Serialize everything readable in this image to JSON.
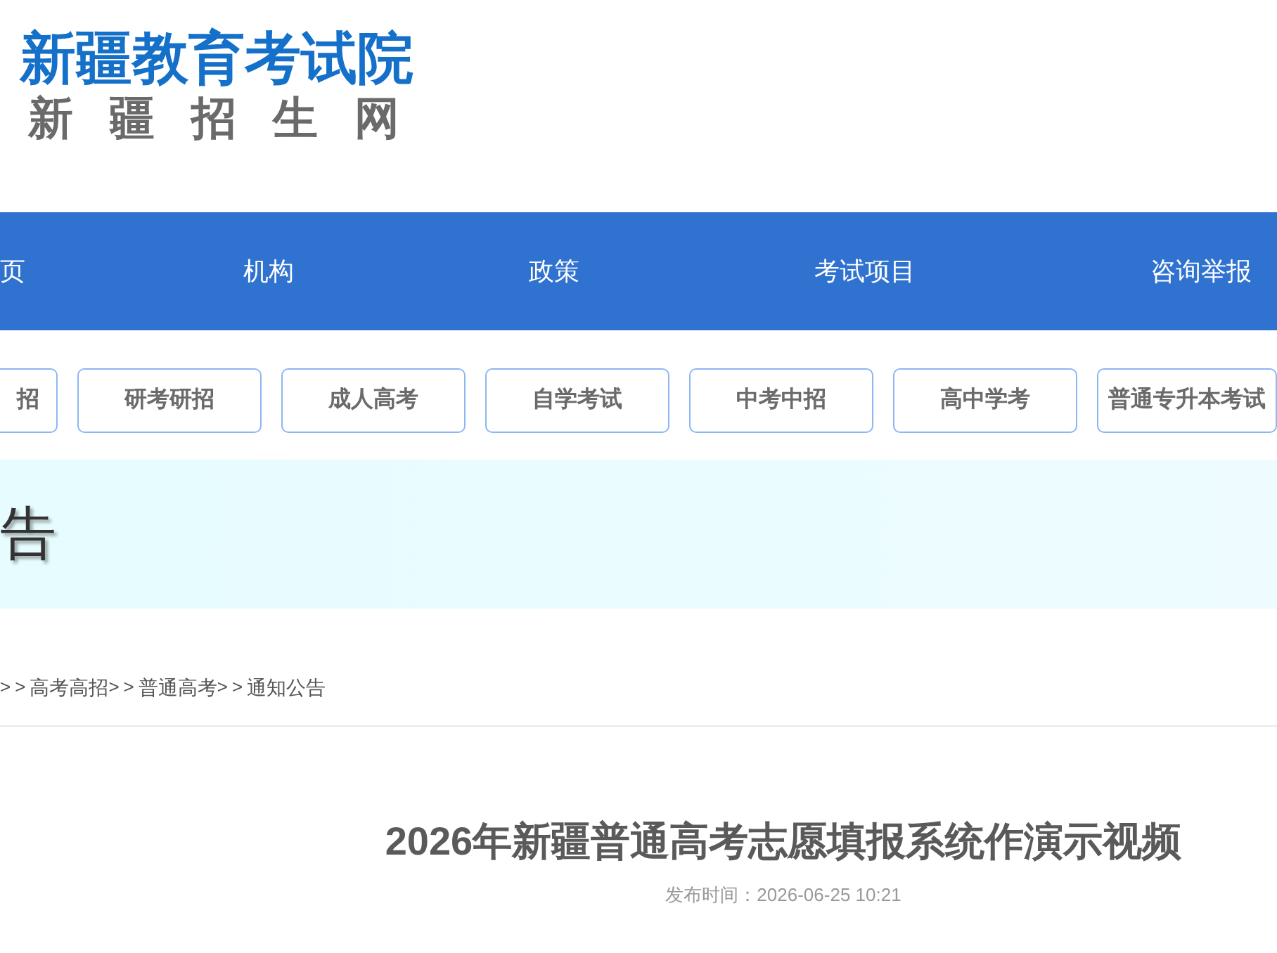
{
  "logo": {
    "title": "新疆教育考试院",
    "subtitle": "新疆招生网"
  },
  "nav": [
    "页",
    "机构",
    "政策",
    "考试项目",
    "咨询举报"
  ],
  "exam_buttons": [
    "招",
    "研考研招",
    "成人高考",
    "自学考试",
    "中考中招",
    "高中学考",
    "普通专升本考试"
  ],
  "banner": {
    "title": "告"
  },
  "breadcrumb": [
    {
      "kind": "separator",
      "text": ">>"
    },
    {
      "kind": "link",
      "text": "高考高招"
    },
    {
      "kind": "separator",
      "text": ">>"
    },
    {
      "kind": "link",
      "text": "普通高考"
    },
    {
      "kind": "separator",
      "text": ">>"
    },
    {
      "kind": "link",
      "text": "通知公告"
    }
  ],
  "article": {
    "title": "2026年新疆普通高考志愿填报系统作演示视频",
    "published": "发布时间：2026-06-25 10:21"
  }
}
